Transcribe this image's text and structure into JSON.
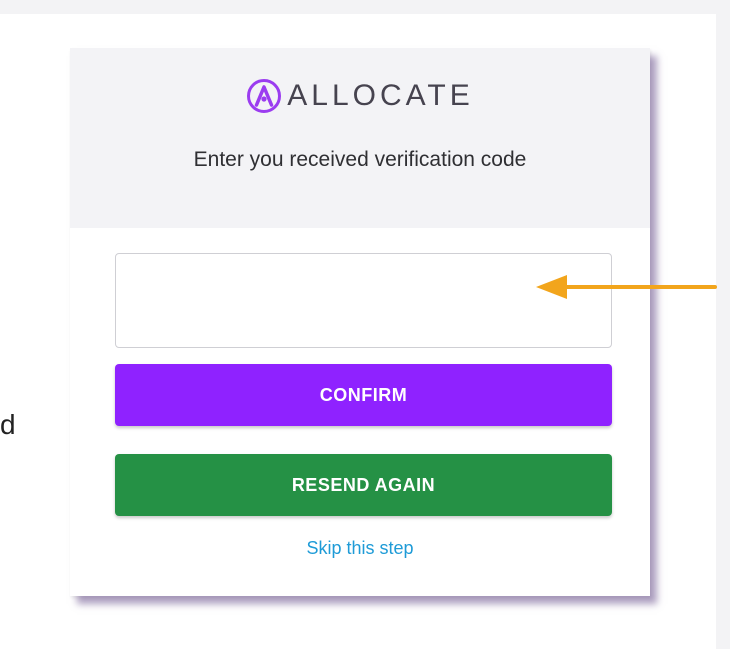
{
  "side_text": "d",
  "brand": {
    "name": "ALLOCATE",
    "logo_icon": "allocate-logo-icon",
    "color": "#9b3cf0"
  },
  "header": {
    "subtitle": "Enter you received verification code"
  },
  "code_input": {
    "value": ""
  },
  "confirm_button": {
    "label": "CONFIRM",
    "color": "#8f22ff"
  },
  "resend_button": {
    "label": "RESEND AGAIN",
    "color": "#259145"
  },
  "skip_link": {
    "label": "Skip this step",
    "color": "#1e9bd7"
  },
  "annotation": {
    "icon": "arrow-left-icon",
    "color": "#f2a51c"
  }
}
